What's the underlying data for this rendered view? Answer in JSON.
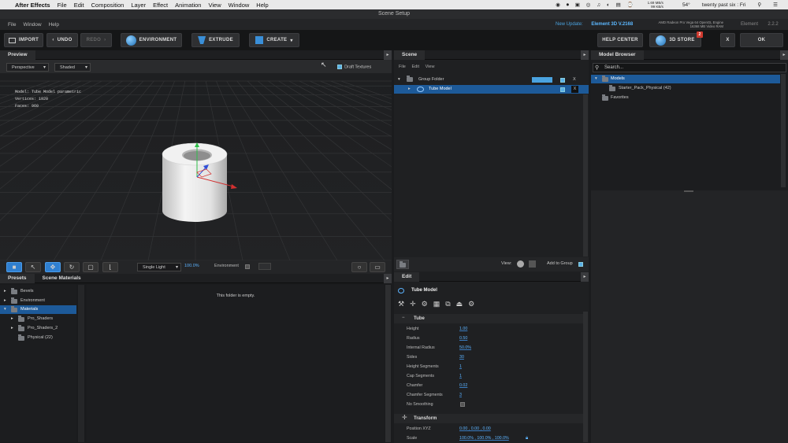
{
  "menubar": {
    "app": "After Effects",
    "items": [
      "File",
      "Edit",
      "Composition",
      "Layer",
      "Effect",
      "Animation",
      "View",
      "Window",
      "Help"
    ],
    "right_items": [
      "1.69 MB/s",
      "99 KB/s",
      "54°",
      "twenty past six : Fri"
    ]
  },
  "window_title": "Scene Setup",
  "app_menu": {
    "items": [
      "File",
      "Window",
      "Help"
    ],
    "update_label": "New Update:",
    "update_version": "Element 3D V.2168",
    "gpu_line1": "AMD Radeon Pro Vega 64 OpenGL Engine",
    "gpu_line2": "16368 MB Video RAM",
    "element_label": "Element",
    "element_version": "2.2.2"
  },
  "toolbar": {
    "import": "IMPORT",
    "undo": "UNDO",
    "redo": "REDO",
    "environment": "ENVIRONMENT",
    "extrude": "EXTRUDE",
    "create": "CREATE",
    "help_center": "HELP CENTER",
    "store": "3D STORE",
    "store_badge": "2",
    "close": "X",
    "ok": "OK"
  },
  "preview": {
    "tab": "Preview",
    "camera": "Perspective",
    "shading": "Shaded",
    "draft_textures": "Draft Textures",
    "model_info": "Model:  Tube Model parametric",
    "vertices_info": "Vertices:  1920",
    "faces_info": "Faces:  960",
    "light": "Single Light",
    "light_value": "100.0%",
    "environment": "Environment"
  },
  "scene": {
    "tab": "Scene",
    "menu": [
      "File",
      "Edit",
      "View"
    ],
    "group_folder": "Group Folder",
    "tube_model": "Tube Model",
    "x_label": "X",
    "view_label": "View:",
    "add_to_group": "Add to Group"
  },
  "browser": {
    "tab": "Model Browser",
    "search_placeholder": "Search...",
    "models": "Models",
    "starter_pack": "Starter_Pack_Physical (42)",
    "favorites": "Favorites"
  },
  "presets": {
    "tab_presets": "Presets",
    "tab_materials": "Scene Materials",
    "bevels": "Bevels",
    "environment": "Environment",
    "materials": "Materials",
    "pro_shaders": "Pro_Shaders",
    "pro_shaders_2": "Pro_Shaders_2",
    "physical": "Physical (22)",
    "empty": "This folder is empty."
  },
  "edit": {
    "tab": "Edit",
    "model_name": "Tube Model",
    "section_tube": "Tube",
    "params": [
      {
        "label": "Height",
        "value": "1.00"
      },
      {
        "label": "Radius",
        "value": "0.50"
      },
      {
        "label": "Internal Radius",
        "value": "50.0%"
      },
      {
        "label": "Sides",
        "value": "30"
      },
      {
        "label": "Height Segments",
        "value": "1"
      },
      {
        "label": "Cap Segments",
        "value": "1"
      },
      {
        "label": "Chamfer",
        "value": "0.02"
      },
      {
        "label": "Chamfer Segments",
        "value": "3"
      }
    ],
    "no_smoothing": "No Smoothing",
    "section_transform": "Transform",
    "position_label": "Position XYZ",
    "position_value": "0.00 ,  0.00 ,  0.00",
    "scale_label": "Scale",
    "scale_value": "100.0% ,  100.0% ,  100.0%"
  },
  "colors": {
    "accent": "#2f7fd0",
    "selection": "#1d5a99",
    "value_blue": "#5cb3ff"
  }
}
